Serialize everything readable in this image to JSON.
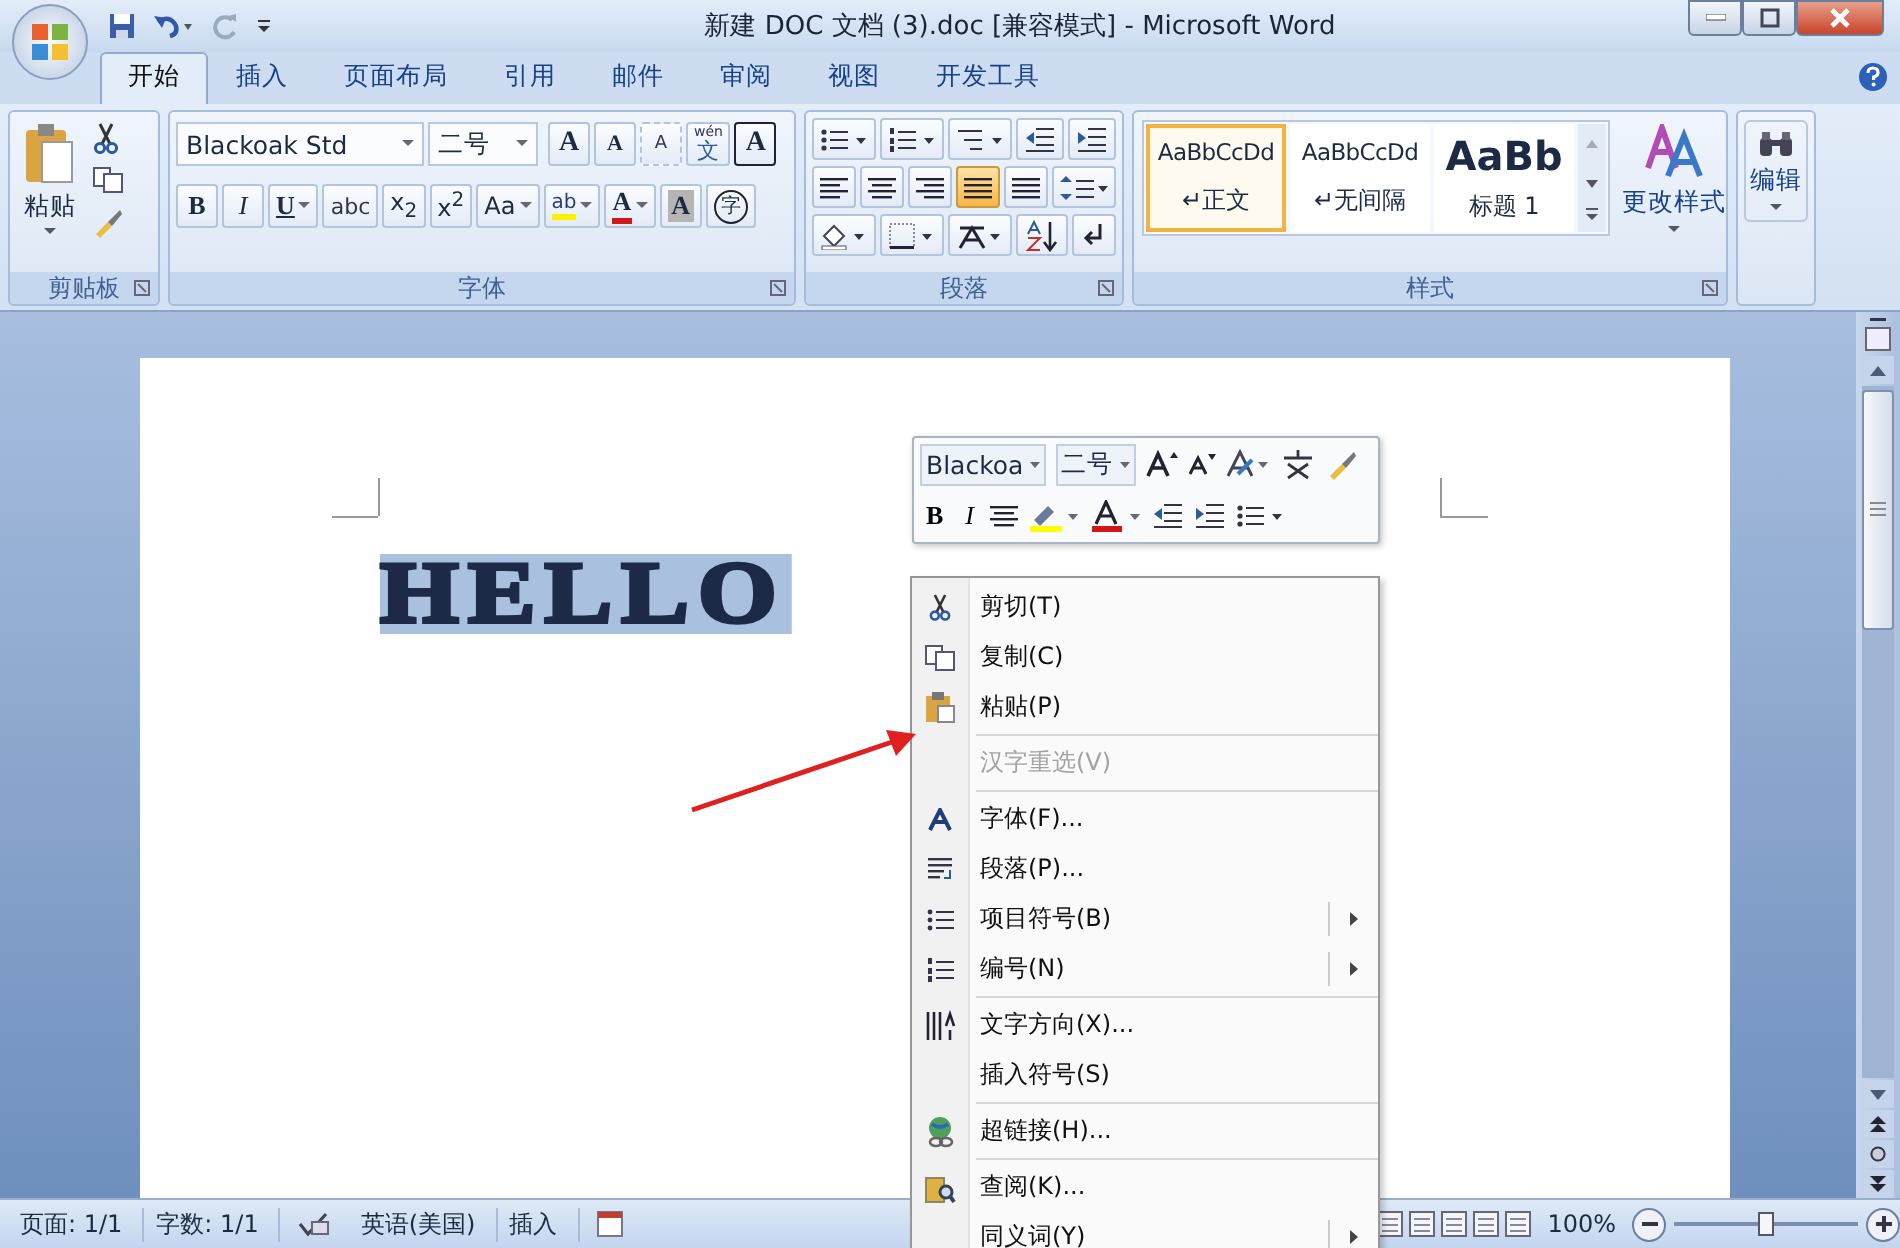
{
  "window": {
    "title": "新建 DOC 文档 (3).doc [兼容模式] - Microsoft Word"
  },
  "tabs": [
    {
      "label": "开始",
      "selected": true
    },
    {
      "label": "插入",
      "selected": false
    },
    {
      "label": "页面布局",
      "selected": false
    },
    {
      "label": "引用",
      "selected": false
    },
    {
      "label": "邮件",
      "selected": false
    },
    {
      "label": "审阅",
      "selected": false
    },
    {
      "label": "视图",
      "selected": false
    },
    {
      "label": "开发工具",
      "selected": false
    }
  ],
  "ribbon": {
    "clipboard": {
      "label": "剪贴板",
      "paste": "粘贴"
    },
    "font": {
      "label": "字体",
      "font_name": "Blackoak Std",
      "font_size": "二号",
      "row1": [
        {
          "kind": "grow",
          "label": "A"
        },
        {
          "kind": "shrink",
          "label": "A"
        },
        {
          "kind": "clear",
          "label": "A"
        },
        {
          "kind": "phonetic",
          "label": "文",
          "ruby": "wén"
        },
        {
          "kind": "border",
          "label": "A"
        }
      ],
      "row2": [
        {
          "kind": "bold",
          "label": "B",
          "dropdown": false
        },
        {
          "kind": "italic",
          "label": "I",
          "dropdown": false
        },
        {
          "kind": "underline",
          "label": "U",
          "dropdown": true
        },
        {
          "kind": "strike",
          "label": "abc",
          "dropdown": false
        },
        {
          "kind": "script",
          "label": "x$_{2}$",
          "dropdown": false
        },
        {
          "kind": "script",
          "label": "x$^{2}$",
          "dropdown": false
        },
        {
          "kind": "case",
          "label": "Aa",
          "dropdown": true
        },
        {
          "kind": "highlight",
          "label": "ab",
          "dropdown": true
        },
        {
          "kind": "fontcolor",
          "label": "A",
          "dropdown": true
        },
        {
          "kind": "shading",
          "label": "A",
          "dropdown": false
        },
        {
          "kind": "enclosed",
          "label": "字",
          "dropdown": false
        }
      ]
    },
    "paragraph": {
      "label": "段落",
      "align": [
        {
          "selected": false
        },
        {
          "selected": false
        },
        {
          "selected": false
        },
        {
          "selected": true
        },
        {
          "selected": false
        }
      ]
    },
    "styles": {
      "label": "样式",
      "items": [
        {
          "kind": "normal",
          "sample": "AaBbCcDd",
          "mark": "↵",
          "name": "正文",
          "selected": true
        },
        {
          "kind": "normal",
          "sample": "AaBbCcDd",
          "mark": "↵",
          "name": "无间隔",
          "selected": false
        },
        {
          "kind": "heading",
          "sample": "AaBb",
          "name": "标题 1",
          "selected": false
        }
      ],
      "change_styles": "更改样式"
    },
    "editing": {
      "label": "编辑"
    }
  },
  "document": {
    "text": "HELLO",
    "selected": true
  },
  "mini_toolbar": {
    "font_name": "Blackoa",
    "font_size": "二号",
    "buttons": [
      {
        "kind": "bold",
        "label": "B"
      },
      {
        "kind": "italic",
        "label": "I"
      }
    ]
  },
  "context_menu": [
    {
      "kind": "item",
      "label": "剪切(T)",
      "disabled": false,
      "submenu": false
    },
    {
      "kind": "item",
      "label": "复制(C)",
      "disabled": false,
      "submenu": false
    },
    {
      "kind": "item",
      "label": "粘贴(P)",
      "disabled": false,
      "submenu": false
    },
    {
      "kind": "separator"
    },
    {
      "kind": "item",
      "label": "汉字重选(V)",
      "disabled": true,
      "submenu": false
    },
    {
      "kind": "separator"
    },
    {
      "kind": "item",
      "label": "字体(F)...",
      "disabled": false,
      "submenu": false
    },
    {
      "kind": "item",
      "label": "段落(P)...",
      "disabled": false,
      "submenu": false
    },
    {
      "kind": "item",
      "label": "项目符号(B)",
      "disabled": false,
      "submenu": true
    },
    {
      "kind": "item",
      "label": "编号(N)",
      "disabled": false,
      "submenu": true
    },
    {
      "kind": "separator"
    },
    {
      "kind": "item",
      "label": "文字方向(X)...",
      "disabled": false,
      "submenu": false
    },
    {
      "kind": "item",
      "label": "插入符号(S)",
      "disabled": false,
      "submenu": false
    },
    {
      "kind": "separator"
    },
    {
      "kind": "item",
      "label": "超链接(H)...",
      "disabled": false,
      "submenu": false
    },
    {
      "kind": "separator"
    },
    {
      "kind": "item",
      "label": "查阅(K)...",
      "disabled": false,
      "submenu": false
    },
    {
      "kind": "item",
      "label": "同义词(Y)",
      "disabled": false,
      "submenu": true
    }
  ],
  "status_bar": {
    "page": "页面: 1/1",
    "words": "字数: 1/1",
    "language": "英语(美国)",
    "mode": "插入",
    "zoom": "100%",
    "zoom_slider": {
      "level": 0.5
    }
  }
}
